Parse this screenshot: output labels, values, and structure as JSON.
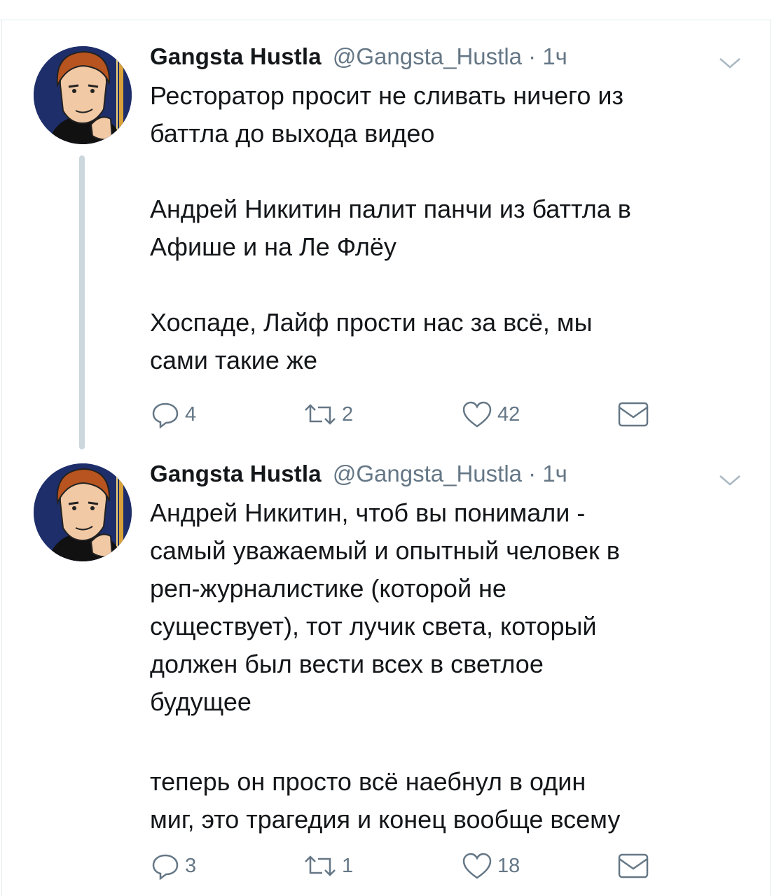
{
  "tweets": [
    {
      "author": {
        "name": "Gangsta Hustla",
        "handle_time": "@Gangsta_Hustla · 1ч"
      },
      "paragraphs": [
        [
          "Ресторатор просит не сливать ничего из",
          "баттла до выхода видео"
        ],
        [
          "Андрей Никитин палит панчи из баттла в",
          "Афише и на Ле Флёу"
        ],
        [
          "Хоспаде, Лайф прости нас за всё, мы",
          "сами такие же"
        ]
      ],
      "actions": {
        "replies": "4",
        "retweets": "2",
        "likes": "42"
      }
    },
    {
      "author": {
        "name": "Gangsta Hustla",
        "handle_time": "@Gangsta_Hustla · 1ч"
      },
      "paragraphs": [
        [
          "Андрей Никитин, чтоб вы понимали -",
          "самый уважаемый и опытный человек в",
          "реп-журналистике (которой не",
          "существует), тот лучик света, который",
          "должен был вести всех в светлое",
          "будущее"
        ],
        [
          "теперь он просто всё наебнул в один",
          "миг, это трагедия и конец вообще всему"
        ]
      ],
      "actions": {
        "replies": "3",
        "retweets": "1",
        "likes": "18"
      }
    }
  ],
  "colors": {
    "text": "#14171a",
    "secondary": "#657786",
    "thread": "#ccd6dd",
    "avatar_bg": "#1e2e6a"
  },
  "icons": [
    "reply-icon",
    "retweet-icon",
    "like-icon",
    "direct-message-icon",
    "chevron-down-icon"
  ]
}
